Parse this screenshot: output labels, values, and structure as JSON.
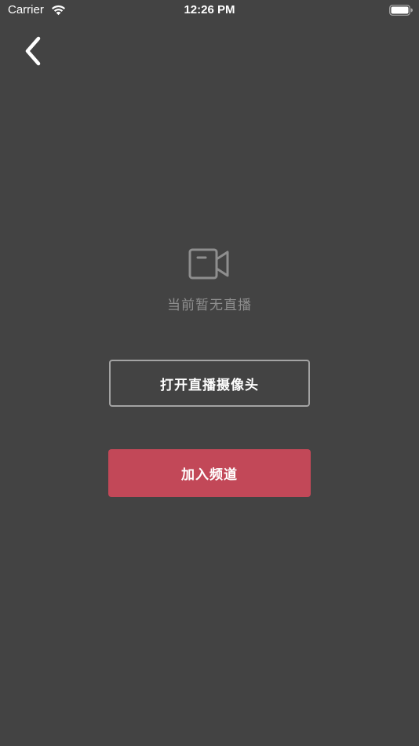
{
  "status_bar": {
    "carrier": "Carrier",
    "time": "12:26 PM",
    "icons": [
      "wifi-icon",
      "battery-icon"
    ]
  },
  "nav": {
    "back_icon": "chevron-left-icon"
  },
  "empty_state": {
    "icon": "video-camera-icon",
    "message": "当前暂无直播"
  },
  "actions": {
    "open_camera_label": "打开直播摄像头",
    "join_channel_label": "加入频道"
  },
  "colors": {
    "background": "#434343",
    "accent": "#c24858",
    "muted_text": "#8e8e8e",
    "outline": "#a3a3a3"
  }
}
